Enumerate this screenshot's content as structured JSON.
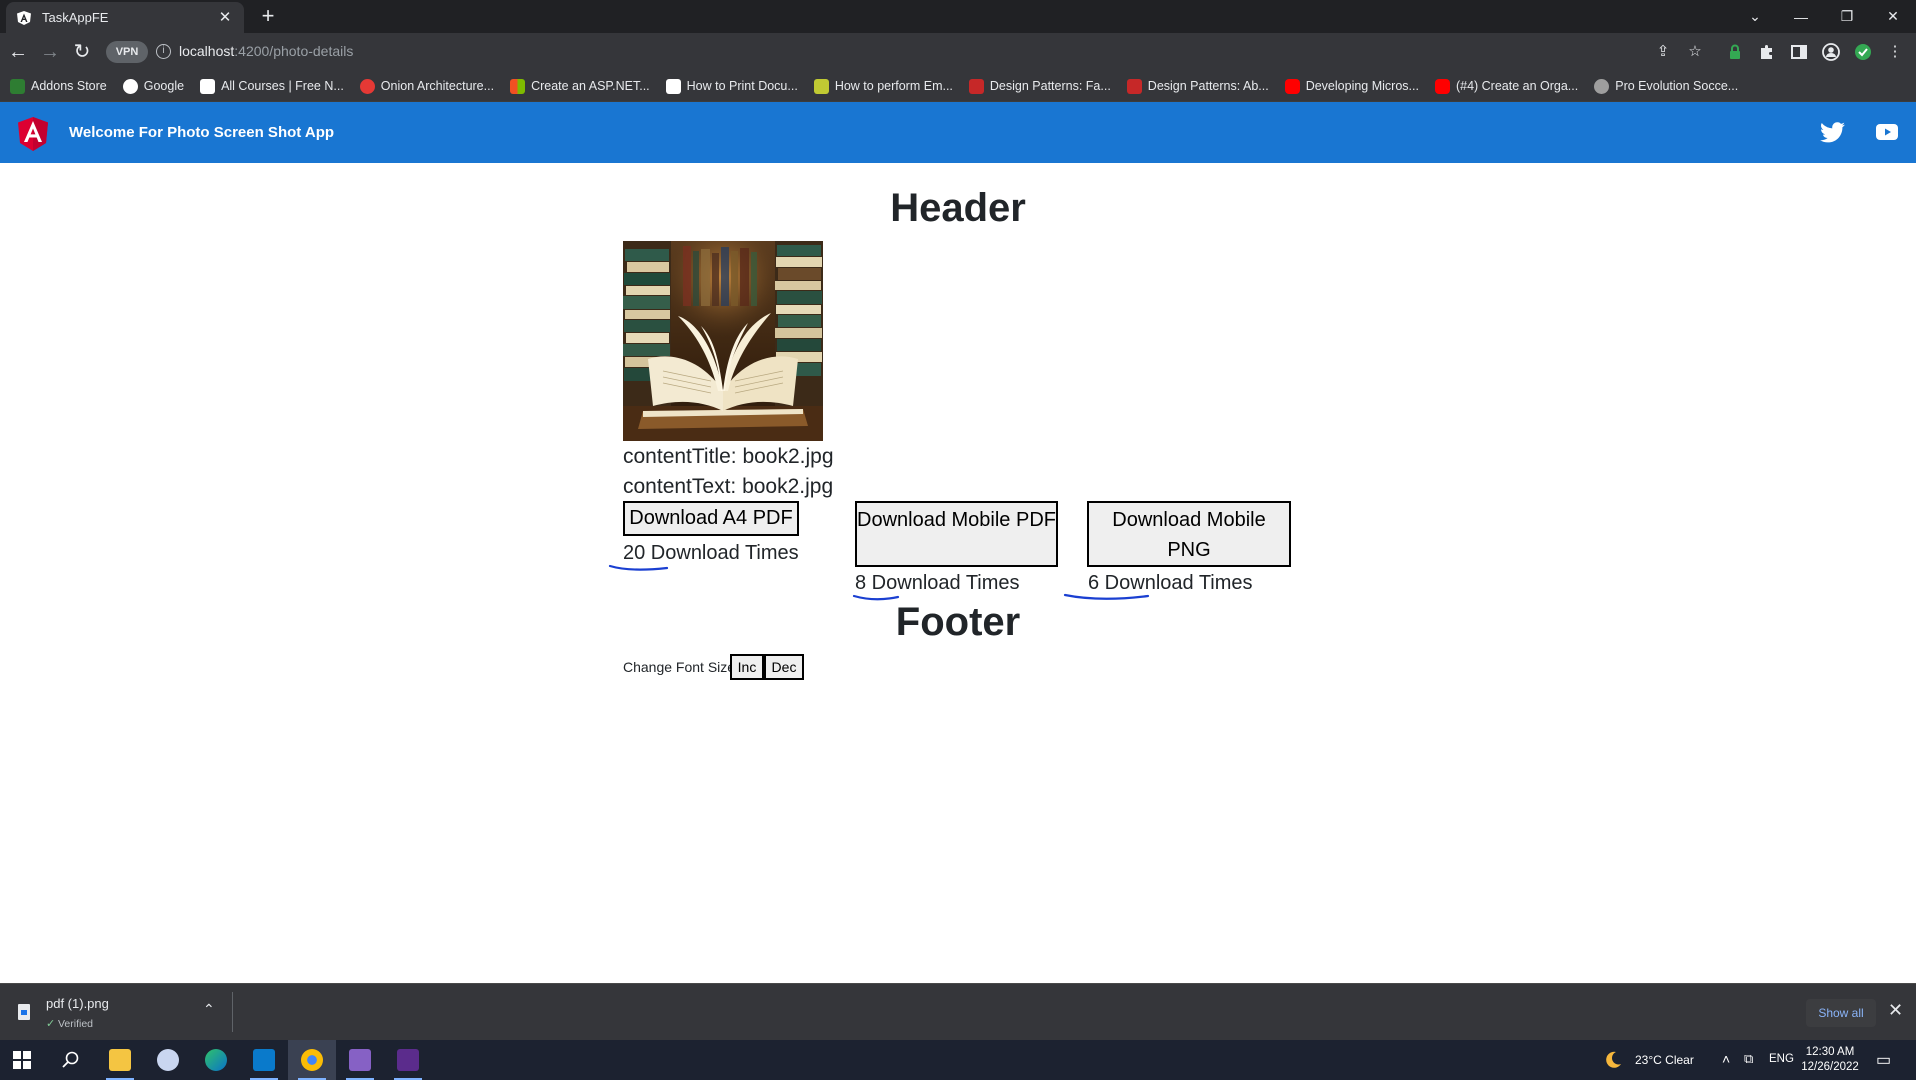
{
  "browser": {
    "tab_title": "TaskAppFE",
    "new_tab_symbol": "+",
    "vpn_label": "VPN",
    "url_host": "localhost",
    "url_path": ":4200/photo-details",
    "bookmarks": [
      {
        "label": "Addons Store",
        "color": "#2e7d32"
      },
      {
        "label": "Google",
        "color": "#ffffff"
      },
      {
        "label": "All Courses | Free N...",
        "color": "#ffffff"
      },
      {
        "label": "Onion Architecture...",
        "color": "#e53935"
      },
      {
        "label": "Create an ASP.NET...",
        "color": "#f4b400"
      },
      {
        "label": "How to Print Docu...",
        "color": "#ffffff"
      },
      {
        "label": "How to perform Em...",
        "color": "#c0ca33"
      },
      {
        "label": "Design Patterns: Fa...",
        "color": "#c62828"
      },
      {
        "label": "Design Patterns: Ab...",
        "color": "#c62828"
      },
      {
        "label": "Developing Micros...",
        "color": "#ff0000"
      },
      {
        "label": "(#4) Create an Orga...",
        "color": "#ff0000"
      },
      {
        "label": "Pro Evolution Socce...",
        "color": "#9e9e9e"
      }
    ]
  },
  "app": {
    "nav_title": "Welcome For Photo Screen Shot App",
    "brand_color": "#1976d2",
    "header": "Header",
    "content_title": "contentTitle: book2.jpg",
    "content_text": "contentText: book2.jpg",
    "buttons": {
      "a4_pdf": "Download A4 PDF",
      "mobile_pdf": "Download Mobile PDF",
      "mobile_png": "Download Mobile PNG"
    },
    "counts": {
      "a4_pdf": "20 Download Times",
      "mobile_pdf": "8 Download Times",
      "mobile_png": "6 Download Times"
    },
    "footer": "Footer",
    "font_size_label": "Change Font Size",
    "inc_label": "Inc",
    "dec_label": "Dec"
  },
  "download_shelf": {
    "filename": "pdf (1).png",
    "status": "Verified",
    "show_all": "Show all"
  },
  "taskbar": {
    "weather": "23°C  Clear",
    "language": "ENG",
    "time": "12:30 AM",
    "date": "12/26/2022"
  }
}
